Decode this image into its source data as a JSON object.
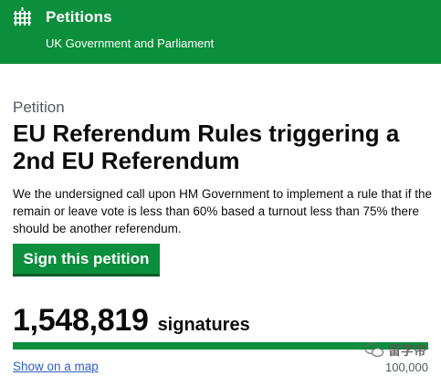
{
  "header": {
    "site_title": "Petitions",
    "site_subtitle": "UK Government and Parliament",
    "icon": "portcullis-icon"
  },
  "petition": {
    "label": "Petition",
    "title": "EU Referendum Rules triggering a 2nd EU Referendum",
    "description": "We the undersigned call upon HM Government to implement a rule that if the remain or leave vote is less than 60% based a turnout less than 75% there should be another referendum.",
    "sign_button": "Sign this petition",
    "signature_count": "1,548,819",
    "signature_unit": "signatures",
    "progress_fraction": 1.0,
    "map_link": "Show on a map",
    "threshold": "100,000"
  },
  "watermark": {
    "text": "留学帝",
    "icon": "wechat-icon"
  },
  "colors": {
    "brand_green": "#0c8f3c",
    "link_blue": "#2b5fbf"
  }
}
